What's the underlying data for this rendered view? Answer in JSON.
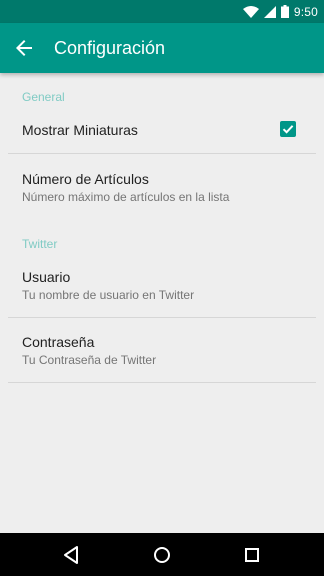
{
  "status_bar": {
    "time": "9:50",
    "icons": [
      "wifi-icon",
      "signal-icon",
      "battery-icon"
    ]
  },
  "app_bar": {
    "title": "Configuración",
    "back_icon": "arrow-back-icon"
  },
  "settings": {
    "general_header": "General",
    "show_thumbnails": {
      "title": "Mostrar Miniaturas",
      "checked": true
    },
    "article_count": {
      "title": "Número de Artículos",
      "summary": "Número máximo de artículos en la lista"
    },
    "twitter_header": "Twitter",
    "username": {
      "title": "Usuario",
      "summary": "Tu nombre de usuario en Twitter"
    },
    "password": {
      "title": "Contraseña",
      "summary": "Tu Contraseña de Twitter"
    }
  },
  "nav_bar": {
    "buttons": [
      "back-triangle-icon",
      "home-circle-icon",
      "recents-square-icon"
    ]
  },
  "colors": {
    "primary": "#009688",
    "primary_dark": "#00796b",
    "accent_header": "#80cbc4",
    "background": "#eeeeee"
  }
}
